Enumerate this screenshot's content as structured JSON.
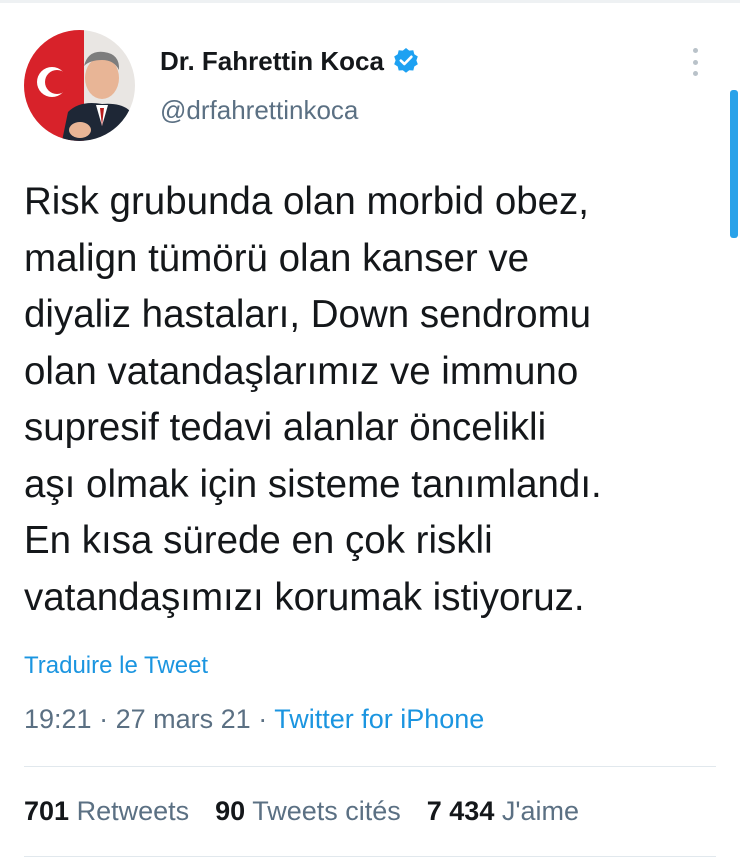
{
  "author": {
    "display_name": "Dr. Fahrettin Koca",
    "handle": "@drfahrettinkoca",
    "verified": true
  },
  "tweet": {
    "lines": [
      "Risk grubunda olan morbid obez,",
      "malign tümörü olan kanser ve",
      "diyaliz hastaları, Down sendromu",
      "olan vatandaşlarımız ve immuno",
      "supresif tedavi alanlar öncelikli",
      "aşı olmak için sisteme tanımlandı.",
      "En kısa sürede en çok riskli",
      "vatandaşımızı korumak istiyoruz."
    ]
  },
  "translate_label": "Traduire le Tweet",
  "meta": {
    "time": "19:21",
    "date": "27 mars 21",
    "separator": "·",
    "source": "Twitter for iPhone"
  },
  "stats": {
    "retweets_count": "701",
    "retweets_label": "Retweets",
    "quotes_count": "90",
    "quotes_label": "Tweets cités",
    "likes_count": "7 434",
    "likes_label": "J'aime"
  },
  "icons": {
    "verified": "verified-badge-icon",
    "more": "more-vertical-icon"
  },
  "colors": {
    "link": "#1b95e0",
    "secondary_text": "#5b7083",
    "verified": "#1da1f2"
  }
}
